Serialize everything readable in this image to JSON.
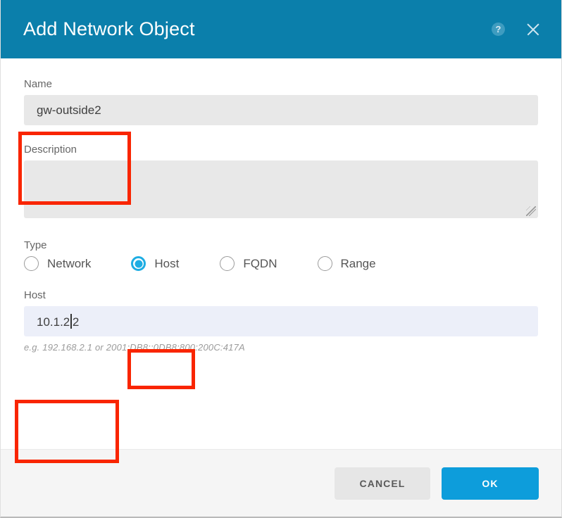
{
  "dialog": {
    "title": "Add Network Object",
    "help_icon": "help-circle-icon",
    "close_icon": "close-icon",
    "accent_color": "#0b7fab",
    "primary_button_color": "#0d9ddb",
    "annotation_color": "#f92500"
  },
  "form": {
    "name": {
      "label": "Name",
      "value": "gw-outside2",
      "placeholder": ""
    },
    "description": {
      "label": "Description",
      "value": "",
      "placeholder": ""
    },
    "type": {
      "label": "Type",
      "options": [
        {
          "label": "Network",
          "selected": false
        },
        {
          "label": "Host",
          "selected": true
        },
        {
          "label": "FQDN",
          "selected": false
        },
        {
          "label": "Range",
          "selected": false
        }
      ],
      "selected": "Host"
    },
    "host": {
      "label": "Host",
      "value_before_caret": "10.1.2",
      "value_after_caret": "2",
      "value": "10.1.22",
      "hint": "e.g. 192.168.2.1 or 2001:DB8::0DB8:800:200C:417A"
    }
  },
  "footer": {
    "cancel_label": "CANCEL",
    "ok_label": "OK"
  }
}
